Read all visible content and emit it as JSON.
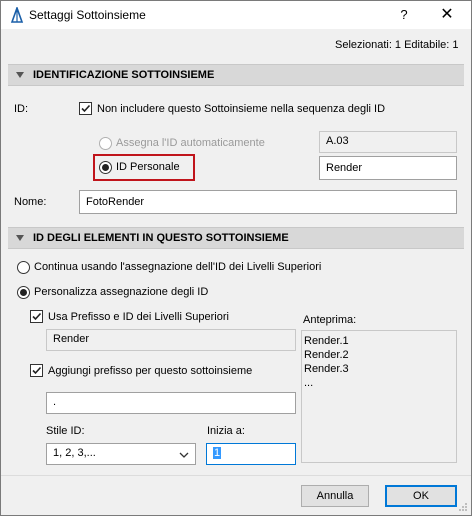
{
  "window": {
    "title": "Settaggi Sottoinsieme",
    "help": "?",
    "close": "✕"
  },
  "selection_info": "Selezionati: 1 Editabile: 1",
  "section_id": {
    "header": "IDENTIFICAZIONE SOTTOINSIEME",
    "id_label": "ID:",
    "exclude_checkbox_label": "Non includere questo Sottoinsieme nella sequenza degli ID",
    "auto_radio_label": "Assegna l'ID automaticamente",
    "auto_value": "A.03",
    "custom_radio_label": "ID Personale",
    "custom_value": "Render",
    "name_label": "Nome:",
    "name_value": "FotoRender"
  },
  "section_elements": {
    "header": "ID DEGLI ELEMENTI IN QUESTO SOTTOINSIEME",
    "continue_radio_label": "Continua usando l'assegnazione dell'ID dei Livelli Superiori",
    "customize_radio_label": "Personalizza assegnazione degli ID",
    "use_prefix_label": "Usa Prefisso e ID dei Livelli Superiori",
    "parent_prefix_value": "Render",
    "add_prefix_label": "Aggiungi prefisso per questo sottoinsieme",
    "prefix_value": ".",
    "style_label": "Stile ID:",
    "style_value": "1, 2, 3,...",
    "start_label": "Inizia a:",
    "start_value": "1",
    "preview_label": "Anteprima:",
    "preview_lines": [
      "Render.1",
      "Render.2",
      "Render.3",
      "..."
    ]
  },
  "buttons": {
    "cancel": "Annulla",
    "ok": "OK"
  },
  "icons": {
    "app": "archicad-icon",
    "checkmark": "checkmark-icon",
    "dropdown": "chevron-down-icon"
  },
  "colors": {
    "highlight": "#c0141b",
    "accent": "#0078d7",
    "section_bg": "#d8d8d8"
  }
}
